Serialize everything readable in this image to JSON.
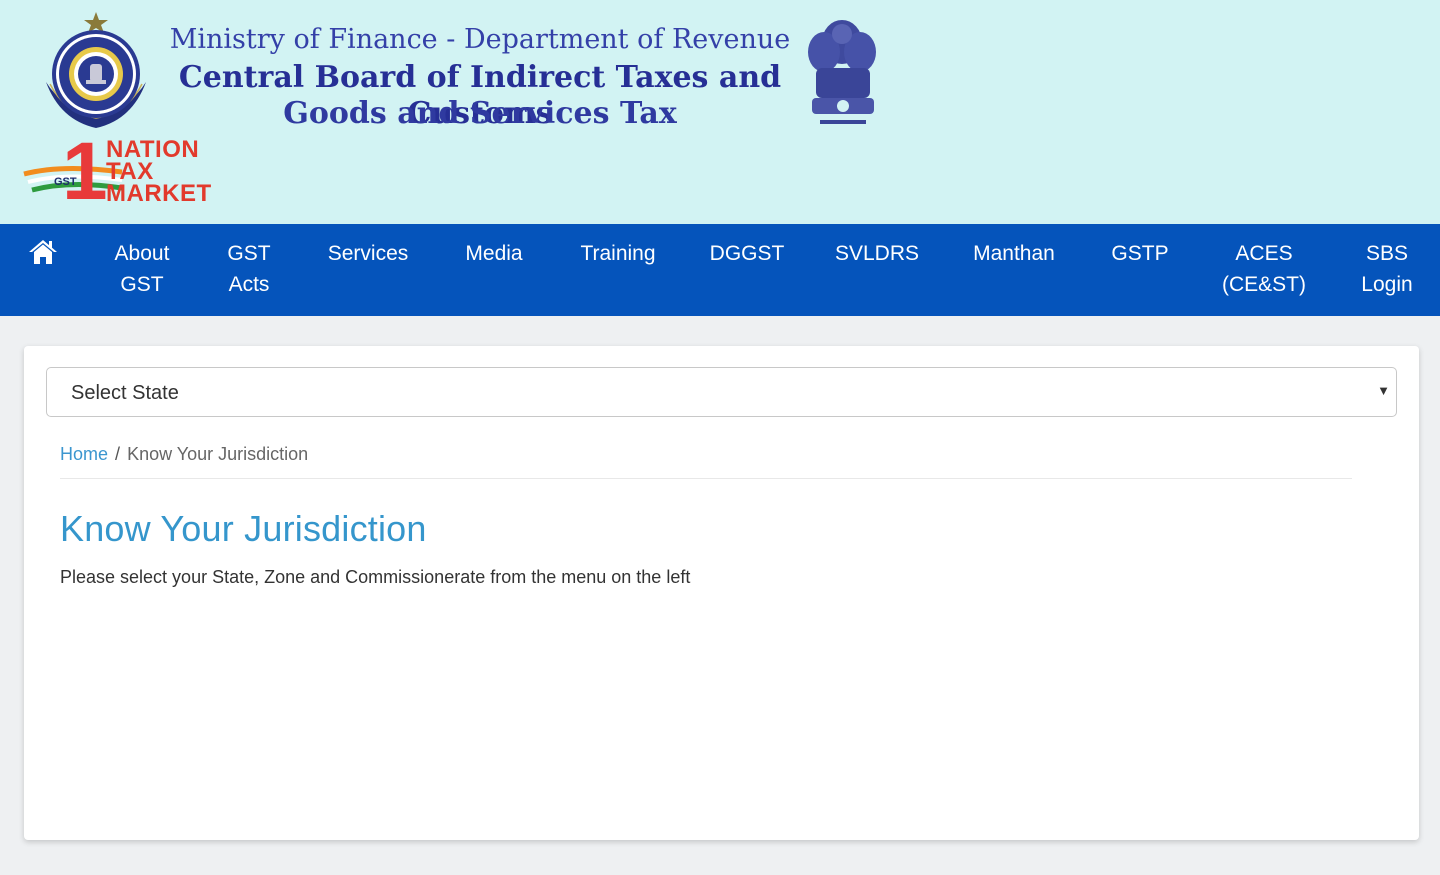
{
  "header": {
    "line1": "Ministry of Finance - Department of Revenue",
    "line2": "Central Board of Indirect Taxes and Customs",
    "line3": "Goods and Services Tax",
    "gst_logo": {
      "numeral": "1",
      "word1": "NATION",
      "word2": "TAX",
      "word3": "MARKET",
      "tag": "GST"
    }
  },
  "nav": {
    "items": [
      {
        "line1": "About",
        "line2": "GST"
      },
      {
        "line1": "GST",
        "line2": "Acts"
      },
      {
        "line1": "Services",
        "line2": ""
      },
      {
        "line1": "Media",
        "line2": ""
      },
      {
        "line1": "Training",
        "line2": ""
      },
      {
        "line1": "DGGST",
        "line2": ""
      },
      {
        "line1": "SVLDRS",
        "line2": ""
      },
      {
        "line1": "Manthan",
        "line2": ""
      },
      {
        "line1": "GSTP",
        "line2": ""
      },
      {
        "line1": "ACES",
        "line2": "(CE&ST)"
      },
      {
        "line1": "SBS",
        "line2": "Login"
      }
    ],
    "home_icon": "home-icon"
  },
  "main": {
    "state_select": {
      "selected": "Select State"
    },
    "breadcrumb": {
      "home": "Home",
      "separator": "/",
      "current": "Know Your Jurisdiction"
    },
    "title": "Know Your Jurisdiction",
    "instruction": "Please select your State, Zone and Commissionerate from the menu on the left"
  },
  "colors": {
    "header_bg": "#d2f3f3",
    "nav_bg": "#0554bb",
    "title_blue": "#3596cc",
    "link_blue": "#3b96cf",
    "heading_navy": "#262f95",
    "logo_red": "#e23a2c"
  }
}
